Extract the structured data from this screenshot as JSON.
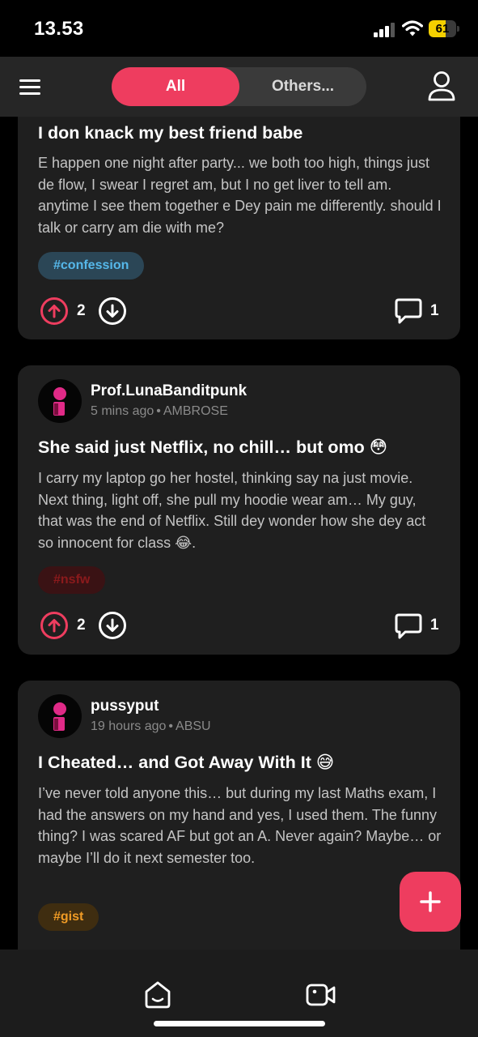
{
  "status_bar": {
    "time": "13.53",
    "battery_percent": "61",
    "battery_level": 0.61,
    "battery_color": "#f4d000"
  },
  "header": {
    "menu_icon": "hamburger-menu-icon",
    "tabs": [
      {
        "label": "All",
        "active": true
      },
      {
        "label": "Others...",
        "active": false
      }
    ],
    "profile_icon": "user-profile-icon",
    "accent_color": "#ee3d5f"
  },
  "posts": [
    {
      "title": "I don knack my best friend babe",
      "body": "E happen one night after party... we both too high, things just de flow, I swear I regret am, but I no get liver to tell am. anytime I see them together e Dey pain me differently. should I talk or carry am die with me?",
      "tag": "#confession",
      "upvotes": "2",
      "comments": "1"
    },
    {
      "username": "Prof.LunaBanditpunk",
      "time_ago": "5 mins ago",
      "separator": "•",
      "school": "AMBROSE",
      "title": "She said just Netflix, no chill… but omo 😳",
      "body": "I carry my laptop go her hostel, thinking say na just movie. Next thing, light off, she pull my hoodie wear am… My guy, that was the end of Netflix. Still dey wonder how she dey act so innocent for class 😂.",
      "tag": "#nsfw",
      "upvotes": "2",
      "comments": "1"
    },
    {
      "username": "pussyput",
      "time_ago": "19 hours ago",
      "separator": "•",
      "school": "ABSU",
      "title": "I Cheated… and Got Away With It 😅",
      "body": "I’ve never told anyone this… but during my last Maths exam, I had the answers on my hand and yes, I used them. The funny thing? I was scared AF but got an A. Never again? Maybe… or maybe I’ll do it next semester too.",
      "tag": "#gist"
    }
  ],
  "fab": {
    "label": "+",
    "icon": "plus-icon"
  },
  "bottom_nav": {
    "items": [
      {
        "icon": "home-icon"
      },
      {
        "icon": "video-icon"
      }
    ]
  }
}
